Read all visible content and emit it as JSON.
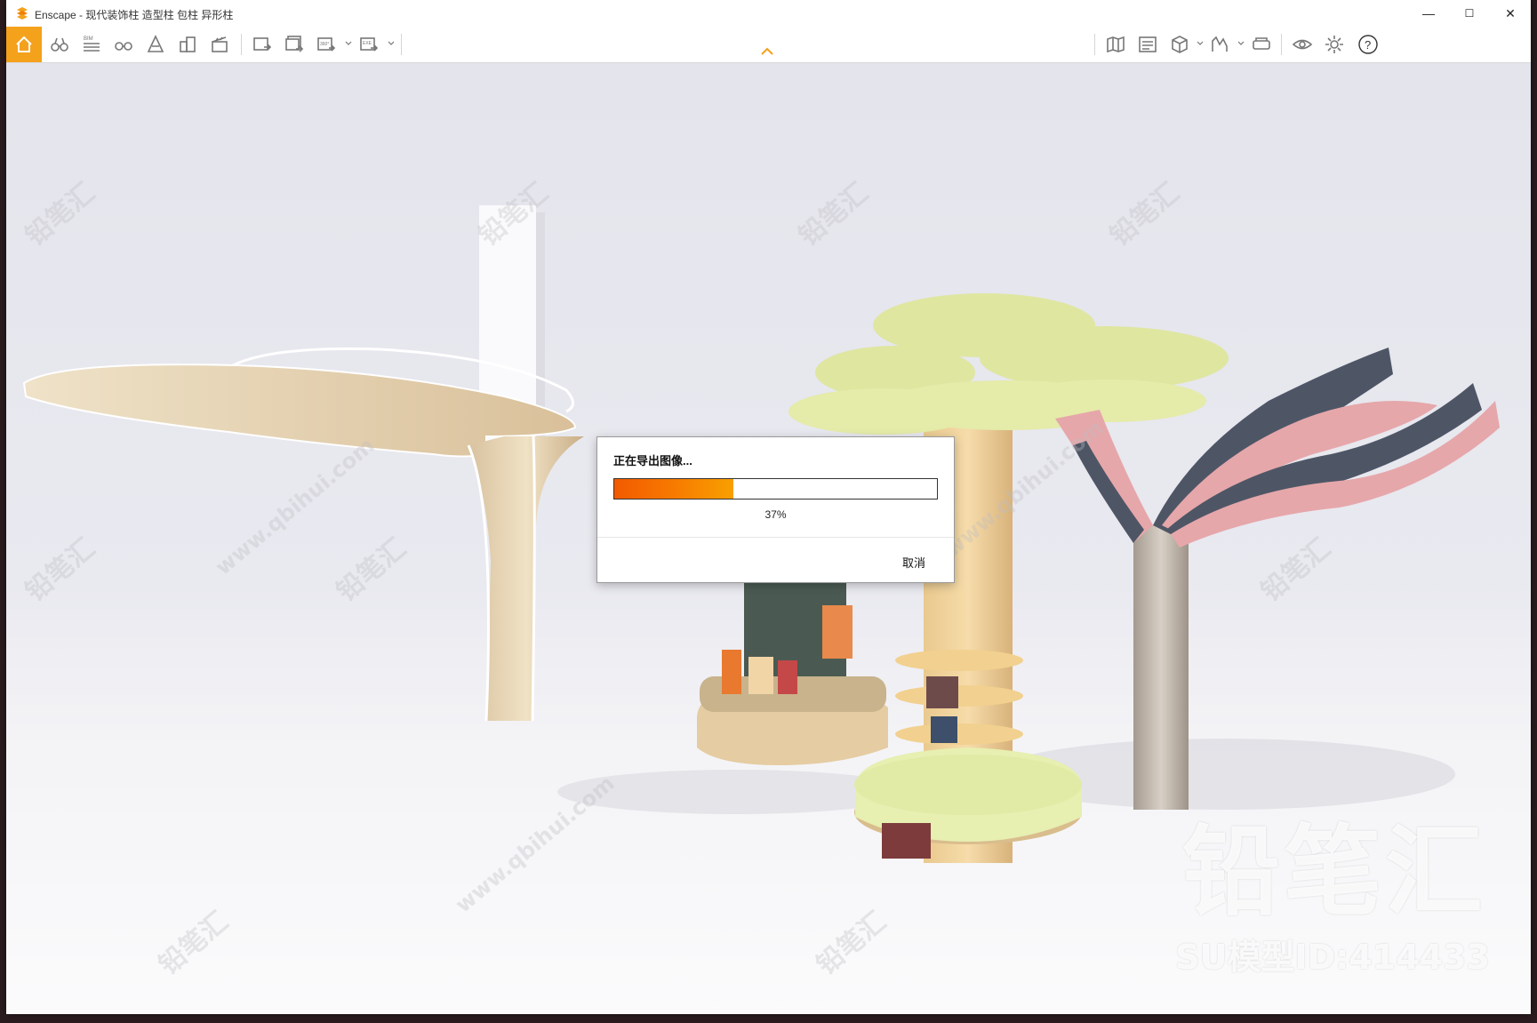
{
  "window": {
    "title": "Enscape - 现代装饰柱 造型柱 包柱 异形柱",
    "controls": {
      "minimize": "—",
      "maximize": "☐",
      "close": "✕"
    }
  },
  "toolbar": {
    "accent_color": "#f4a11c",
    "left_tools": [
      {
        "name": "home",
        "icon": "home-icon"
      },
      {
        "name": "views",
        "icon": "binoculars-icon"
      },
      {
        "name": "bim",
        "icon": "bim-info-icon",
        "label": "BIM"
      },
      {
        "name": "walk",
        "icon": "walk-icon"
      },
      {
        "name": "atmosphere",
        "icon": "atmosphere-icon"
      },
      {
        "name": "assets",
        "icon": "asset-library-icon"
      },
      {
        "name": "video",
        "icon": "video-editor-icon"
      },
      {
        "name": "screenshot",
        "icon": "render-image-icon"
      },
      {
        "name": "batch",
        "icon": "batch-render-icon"
      },
      {
        "name": "panorama",
        "icon": "panorama-icon",
        "label": "360°"
      },
      {
        "name": "exe",
        "icon": "export-exe-icon",
        "label": "EXE"
      }
    ],
    "right_tools": [
      {
        "name": "minimap",
        "icon": "map-icon"
      },
      {
        "name": "info",
        "icon": "info-panel-icon"
      },
      {
        "name": "cube",
        "icon": "view-cube-icon"
      },
      {
        "name": "chart",
        "icon": "chart-icon"
      },
      {
        "name": "vr",
        "icon": "vr-headset-icon"
      },
      {
        "name": "visual-settings",
        "icon": "eye-icon"
      },
      {
        "name": "settings",
        "icon": "gear-icon"
      },
      {
        "name": "help",
        "icon": "help-icon",
        "label": "?"
      }
    ]
  },
  "dialog": {
    "title": "正在导出图像...",
    "progress": 0.37,
    "progress_text": "37%",
    "cancel_label": "取消"
  },
  "watermark": {
    "brand": "铅笔汇",
    "model_id": "SU模型ID:414433",
    "site": "www.qbihui.com",
    "tile_text": "铅笔汇"
  },
  "scene_colors": {
    "wood": "#e8d6b8",
    "green_canopy": "#dfe6a0",
    "pink_petal": "#e6a7aa",
    "slate_petal": "#4e5666",
    "dark_column": "#4a5a52"
  }
}
